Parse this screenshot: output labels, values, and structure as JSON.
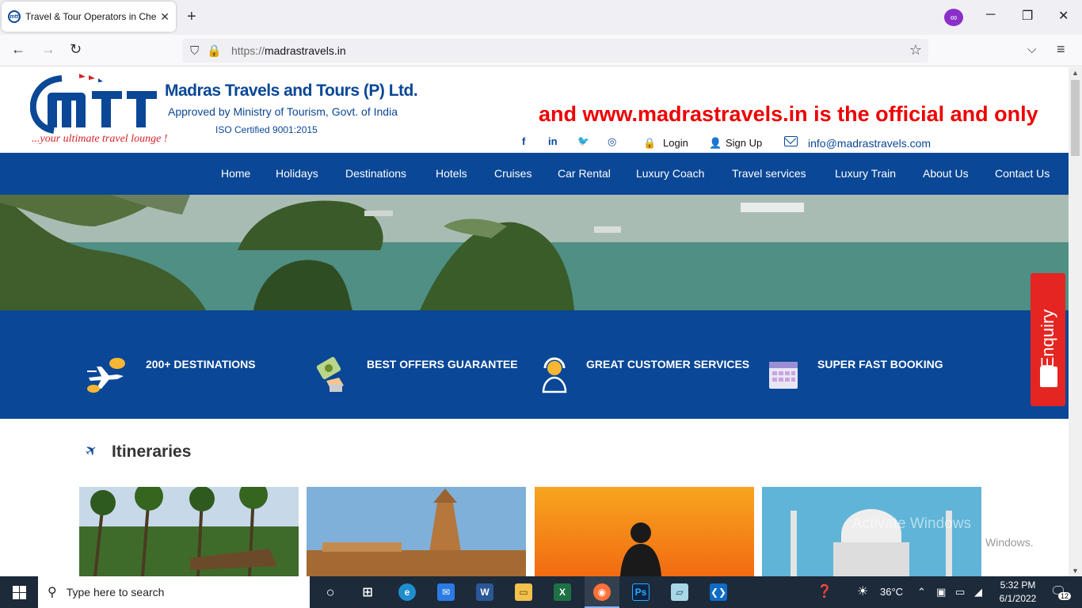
{
  "browser": {
    "tab_title": "Travel & Tour Operators in Chennai",
    "tab_favicon_text": "mtt",
    "url_scheme": "https://",
    "url_host": "madrastravels.in",
    "new_tab": "+",
    "tab_close": "✕"
  },
  "header": {
    "logo_text": "mtt",
    "logo_tagline": "...your ultimate travel lounge !",
    "company_name": "Madras Travels and Tours (P) Ltd.",
    "approved_line": "Approved by Ministry of Tourism, Govt. of India",
    "iso_line": "ISO Certified 9001:2015",
    "marquee_text": "and www.madrastravels.in is the official and only w",
    "social": {
      "facebook": "f",
      "linkedin": "in",
      "twitter": "🐦",
      "instagram": "◎"
    },
    "login_label": "Login",
    "signup_label": "Sign Up",
    "email": "info@madrastravels.com"
  },
  "menu": [
    "Home",
    "Holidays",
    "Destinations",
    "Hotels",
    "Cruises",
    "Car Rental",
    "Luxury Coach",
    "Travel services",
    "Luxury Train",
    "About Us",
    "Contact Us"
  ],
  "features": [
    {
      "label": "200+ DESTINATIONS",
      "icon": "plane-cloud-icon"
    },
    {
      "label": "BEST OFFERS GUARANTEE",
      "icon": "money-hand-icon"
    },
    {
      "label": "GREAT CUSTOMER SERVICES",
      "icon": "headset-agent-icon"
    },
    {
      "label": "SUPER FAST BOOKING",
      "icon": "calendar-icon"
    }
  ],
  "enquiry_label": "Enquiry",
  "itineraries_title": "Itineraries",
  "watermark": {
    "line1": "Activate Windows",
    "line2": "Windows."
  },
  "taskbar": {
    "search_placeholder": "Type here to search",
    "weather": "36°C",
    "time": "5:32 PM",
    "date": "6/1/2022",
    "notifications": "12"
  },
  "colors": {
    "brand_blue": "#0a4796",
    "accent_red": "#e52521",
    "marquee_red": "#ee0000"
  }
}
